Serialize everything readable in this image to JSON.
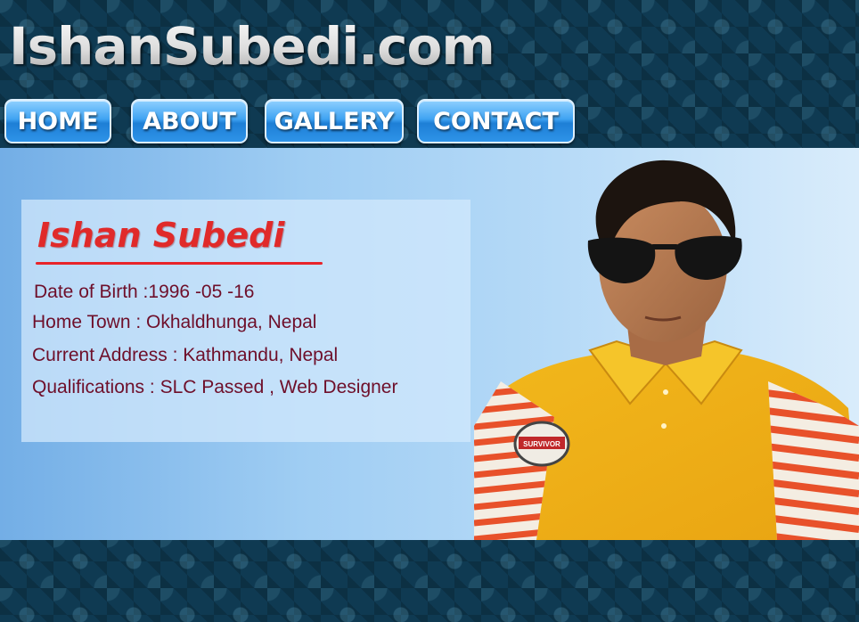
{
  "site": {
    "title": "IshanSubedi.com"
  },
  "nav": {
    "items": [
      {
        "label": "HOME"
      },
      {
        "label": "ABOUT"
      },
      {
        "label": "GALLERY"
      },
      {
        "label": "CONTACT"
      }
    ]
  },
  "profile": {
    "name": "Ishan Subedi",
    "lines": [
      "Date of Birth :1996 -05 -16",
      "Home Town : Okhaldhunga, Nepal",
      "Current Address : Kathmandu, Nepal",
      "Qualifications : SLC Passed , Web Designer"
    ],
    "badge_text": "SURVIVOR"
  },
  "colors": {
    "nav_button": "#2e93e8",
    "name_heading": "#e02a2a",
    "info_text": "#6e0f2a",
    "header_bg": "#0f3a52"
  }
}
